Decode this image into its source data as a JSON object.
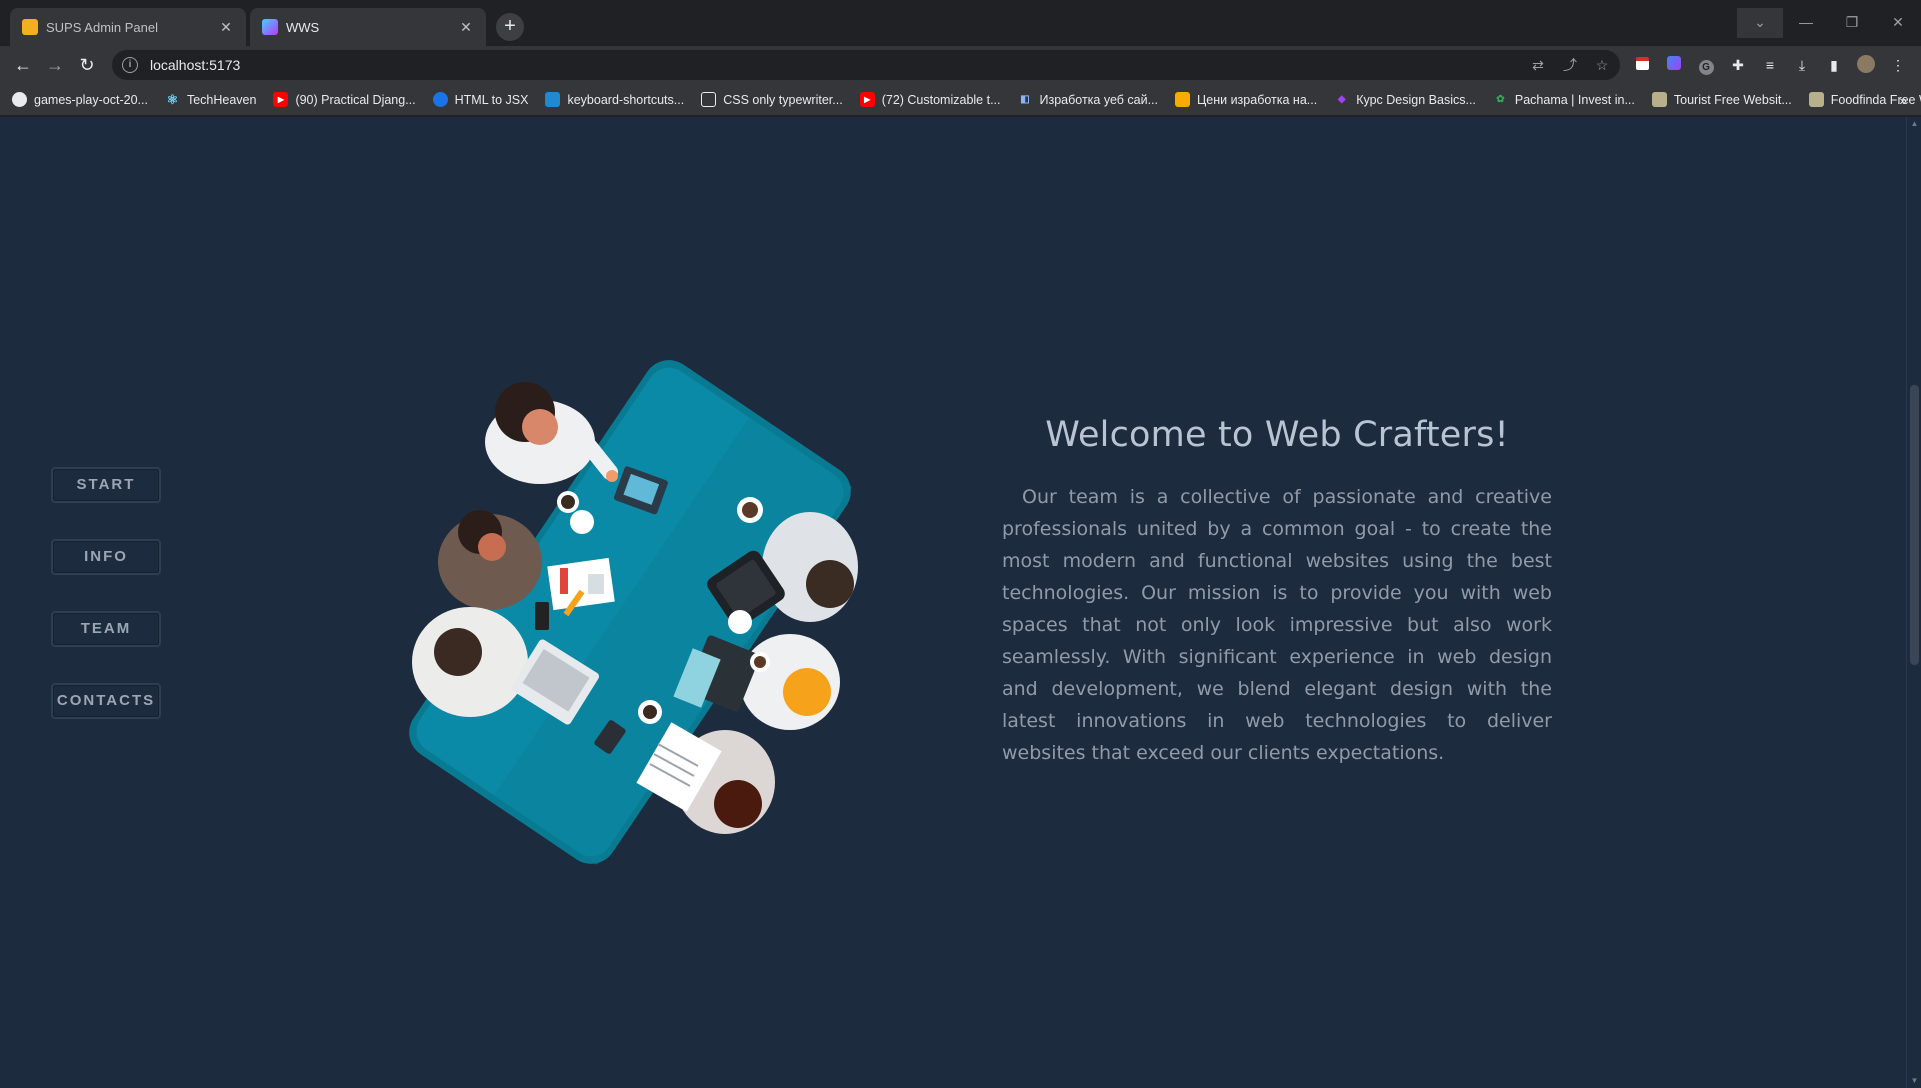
{
  "browser": {
    "tabs": [
      {
        "title": "SUPS Admin Panel",
        "active": false
      },
      {
        "title": "WWS",
        "active": true
      }
    ],
    "new_tab_label": "+",
    "url": "localhost:5173",
    "bookmarks": [
      {
        "label": "games-play-oct-20...",
        "icon": "github-icon"
      },
      {
        "label": "TechHeaven",
        "icon": "react-icon"
      },
      {
        "label": "(90) Practical Djang...",
        "icon": "youtube-icon"
      },
      {
        "label": "HTML to JSX",
        "icon": "transform-icon"
      },
      {
        "label": "keyboard-shortcuts...",
        "icon": "vscode-icon"
      },
      {
        "label": "CSS only typewriter...",
        "icon": "codepen-icon"
      },
      {
        "label": "(72) Customizable t...",
        "icon": "youtube-icon"
      },
      {
        "label": "Изработка уеб сай...",
        "icon": "site-icon"
      },
      {
        "label": "Цени изработка на...",
        "icon": "site-icon"
      },
      {
        "label": "Курс Design Basics...",
        "icon": "course-icon"
      },
      {
        "label": "Pachama | Invest in...",
        "icon": "leaf-icon"
      },
      {
        "label": "Tourist Free Websit...",
        "icon": "folder-icon"
      },
      {
        "label": "Foodfinda Free We...",
        "icon": "folder-icon"
      }
    ],
    "bookmarks_overflow": "»"
  },
  "page": {
    "nav": [
      {
        "label": "START"
      },
      {
        "label": "INFO"
      },
      {
        "label": "TEAM"
      },
      {
        "label": "CONTACTS"
      }
    ],
    "title": "Welcome to Web Crafters!",
    "description": "Our team is a collective of passionate and creative professionals united by a common goal - to create the most modern and functional websites using the best technologies. Our mission is to provide you with web spaces that not only look impressive but also work seamlessly. With significant experience in web design and development, we blend elegant design with the latest innovations in web technologies to deliver websites that exceed our clients expectations.",
    "colors": {
      "background": "#1d2b3e",
      "table": "#0a8aa6",
      "accent": "#f7a21b"
    }
  }
}
